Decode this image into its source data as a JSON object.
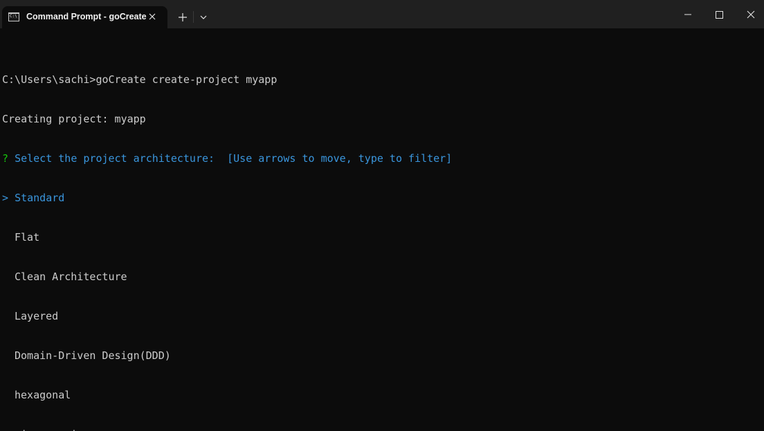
{
  "window": {
    "tab_title": "Command Prompt - goCreate",
    "tab_icon": "command-prompt-icon",
    "tab_icon_glyph": "C:\\"
  },
  "colors": {
    "background": "#0c0c0c",
    "titlebar": "#202020",
    "text": "#cccccc",
    "prompt_green": "#16c60c",
    "accent_blue": "#3a96dd"
  },
  "terminal": {
    "command_line": "C:\\Users\\sachi>goCreate create-project myapp",
    "status_line": "Creating project: myapp",
    "question_mark": "?",
    "question": "Select the project architecture:",
    "hint": "[Use arrows to move, type to filter]",
    "cursor": ">",
    "selected_option": "Standard",
    "options": [
      "Flat",
      "Clean Architecture",
      "Layered",
      "Domain-Driven Design(DDD)",
      "hexagonal",
      "microservices"
    ]
  }
}
